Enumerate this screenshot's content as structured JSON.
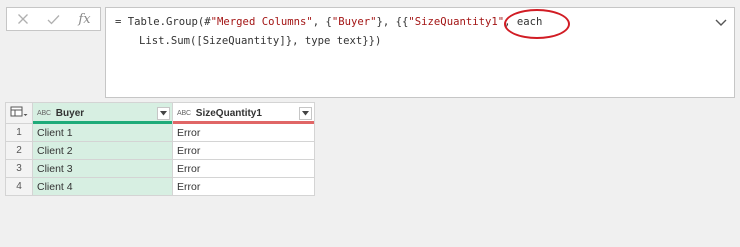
{
  "formula_bar": {
    "fx_label": "fx",
    "formula": {
      "p1": "= Table.Group(#",
      "s1": "\"Merged Columns\"",
      "p2": ", {",
      "s2": "\"Buyer\"",
      "p3": "}, {{",
      "s3": "\"SizeQuantity1\"",
      "p4": ", each List.Sum([SizeQuantity]}, type text}})"
    }
  },
  "table": {
    "columns": [
      {
        "type_icon": "ABC",
        "label": "Buyer",
        "quality_color": "#1eab79"
      },
      {
        "type_icon": "ABC",
        "label": "SizeQuantity1",
        "quality_color": "#e06666"
      }
    ],
    "rows": [
      {
        "num": "1",
        "buyer": "Client 1",
        "qty": "Error"
      },
      {
        "num": "2",
        "buyer": "Client 2",
        "qty": "Error"
      },
      {
        "num": "3",
        "buyer": "Client 3",
        "qty": "Error"
      },
      {
        "num": "4",
        "buyer": "Client 4",
        "qty": "Error"
      }
    ]
  },
  "colors": {
    "highlight": "#d11c24",
    "selected_column": "#d7efe2"
  },
  "icons": {
    "cancel": "close-icon",
    "commit": "check-icon",
    "expand": "chevron-down-icon",
    "table_menu": "table-icon"
  }
}
